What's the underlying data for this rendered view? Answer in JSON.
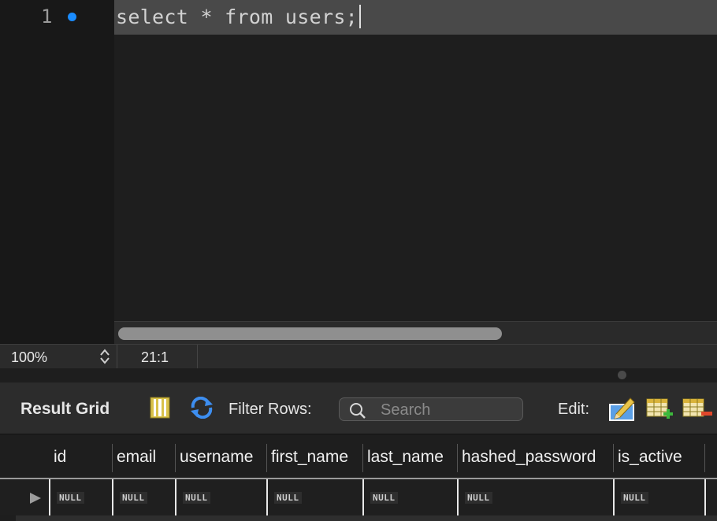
{
  "editor": {
    "line_number": "1",
    "code": "select * from users;"
  },
  "statusbar": {
    "zoom": "100%",
    "cursor_position": "21:1"
  },
  "toolbar": {
    "result_grid_label": "Result Grid",
    "filter_label": "Filter Rows:",
    "search_placeholder": "Search",
    "edit_label": "Edit:",
    "icons": [
      "form-editor-icon",
      "refresh-icon",
      "edit-row-icon",
      "add-row-icon",
      "delete-row-icon"
    ]
  },
  "grid": {
    "columns": [
      "id",
      "email",
      "username",
      "first_name",
      "last_name",
      "hashed_password",
      "is_active"
    ],
    "rows": [
      [
        "NULL",
        "NULL",
        "NULL",
        "NULL",
        "NULL",
        "NULL",
        "NULL"
      ]
    ]
  },
  "colors": {
    "accent_blue": "#1a8cff",
    "editor_bg": "#1e1e1e",
    "highlight_line": "#494949"
  }
}
